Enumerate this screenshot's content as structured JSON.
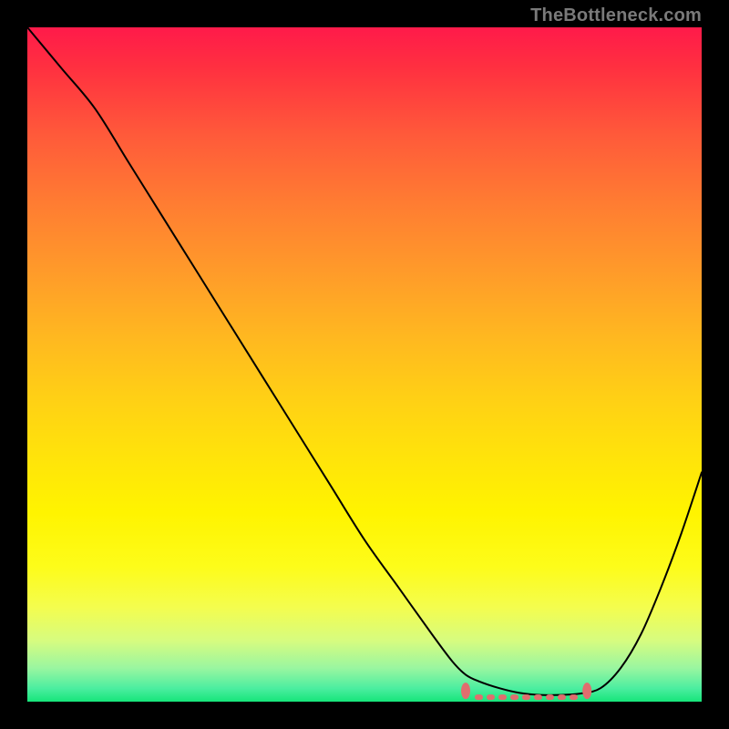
{
  "watermark": "TheBottleneck.com",
  "colors": {
    "frame": "#000000",
    "curve": "#000000",
    "markers": "#e06e6e",
    "gradient_top": "#ff1a4a",
    "gradient_bottom": "#16e57a"
  },
  "chart_data": {
    "type": "line",
    "title": "",
    "xlabel": "",
    "ylabel": "",
    "xlim": [
      0,
      100
    ],
    "ylim": [
      0,
      100
    ],
    "grid": false,
    "legend": false,
    "series": [
      {
        "name": "bottleneck-curve",
        "x": [
          0,
          5,
          10,
          15,
          20,
          25,
          30,
          35,
          40,
          45,
          50,
          55,
          60,
          63,
          65,
          67,
          70,
          73,
          76,
          79,
          82,
          85,
          88,
          91,
          94,
          97,
          100
        ],
        "y": [
          100,
          94,
          88,
          80,
          72,
          64,
          56,
          48,
          40,
          32,
          24,
          17,
          10,
          6,
          4,
          3,
          2,
          1.3,
          1.0,
          1.0,
          1.2,
          2,
          5,
          10,
          17,
          25,
          34
        ]
      }
    ],
    "annotations": [
      {
        "name": "flat-region-markers",
        "x_range": [
          65,
          83
        ],
        "y": 1.2
      }
    ]
  }
}
